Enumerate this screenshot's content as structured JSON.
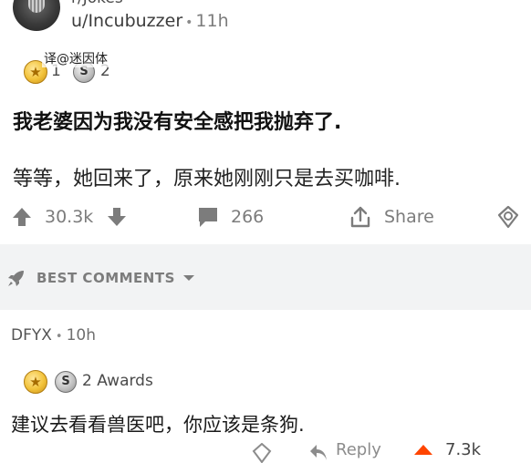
{
  "post": {
    "subreddit": "r/Jokes",
    "author": "u/Incubuzzer",
    "separator": "•",
    "time": "11h",
    "watermark": "译@迷因体",
    "awards": {
      "gold_count": "1",
      "silver_count": "2"
    },
    "title": "我老婆因为我没有安全感把我抛弃了.",
    "body": "等等，她回来了，原来她刚刚只是去买咖啡.",
    "actions": {
      "score": "30.3k",
      "comments": "266",
      "share_label": "Share"
    }
  },
  "section": {
    "sort_label": "BEST COMMENTS"
  },
  "comment": {
    "author": "DFYX",
    "separator": "•",
    "time": "10h",
    "awards_label": "2 Awards",
    "text": "建议去看看兽医吧，你应该是条狗.",
    "actions": {
      "reply_label": "Reply",
      "score": "7.3k"
    }
  },
  "colors": {
    "text_primary": "#1a1a1b",
    "text_muted": "#7c7c7c",
    "section_band": "#f2f3f4",
    "upvote_orange": "#ff4500",
    "award_gold": "#f2c23a"
  },
  "icons": [
    "subreddit-avatar-icon",
    "gold-award-icon",
    "silver-award-icon",
    "upvote-icon",
    "downvote-icon",
    "comment-icon",
    "share-icon",
    "award-icon",
    "rocket-icon",
    "chevron-down-icon",
    "reply-icon"
  ]
}
